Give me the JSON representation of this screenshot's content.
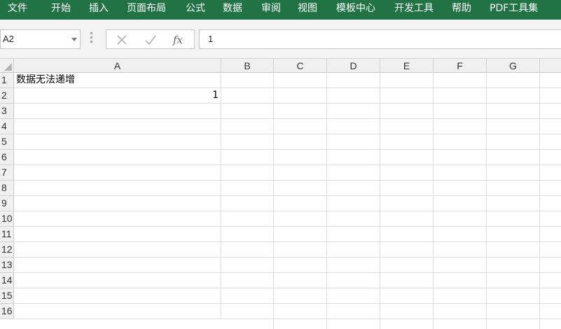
{
  "ribbon": {
    "tabs": [
      {
        "label": "文件"
      },
      {
        "label": "开始"
      },
      {
        "label": "插入"
      },
      {
        "label": "页面布局"
      },
      {
        "label": "公式"
      },
      {
        "label": "数据"
      },
      {
        "label": "审阅"
      },
      {
        "label": "视图"
      },
      {
        "label": "模板中心"
      },
      {
        "label": "开发工具"
      },
      {
        "label": "帮助"
      },
      {
        "label": "PDF工具集"
      }
    ],
    "color": "#217346"
  },
  "formula_bar": {
    "name_box": "A2",
    "cancel_icon": "close-icon",
    "enter_icon": "check-icon",
    "function_label": "fx",
    "value": "1"
  },
  "grid": {
    "columns": [
      "A",
      "B",
      "C",
      "D",
      "E",
      "F",
      "G"
    ],
    "rows": [
      "1",
      "2",
      "3",
      "4",
      "5",
      "6",
      "7",
      "8",
      "9",
      "10",
      "11",
      "12",
      "13",
      "14",
      "15",
      "16"
    ],
    "cells": {
      "A1": "数据无法递增",
      "A2": "1"
    }
  }
}
